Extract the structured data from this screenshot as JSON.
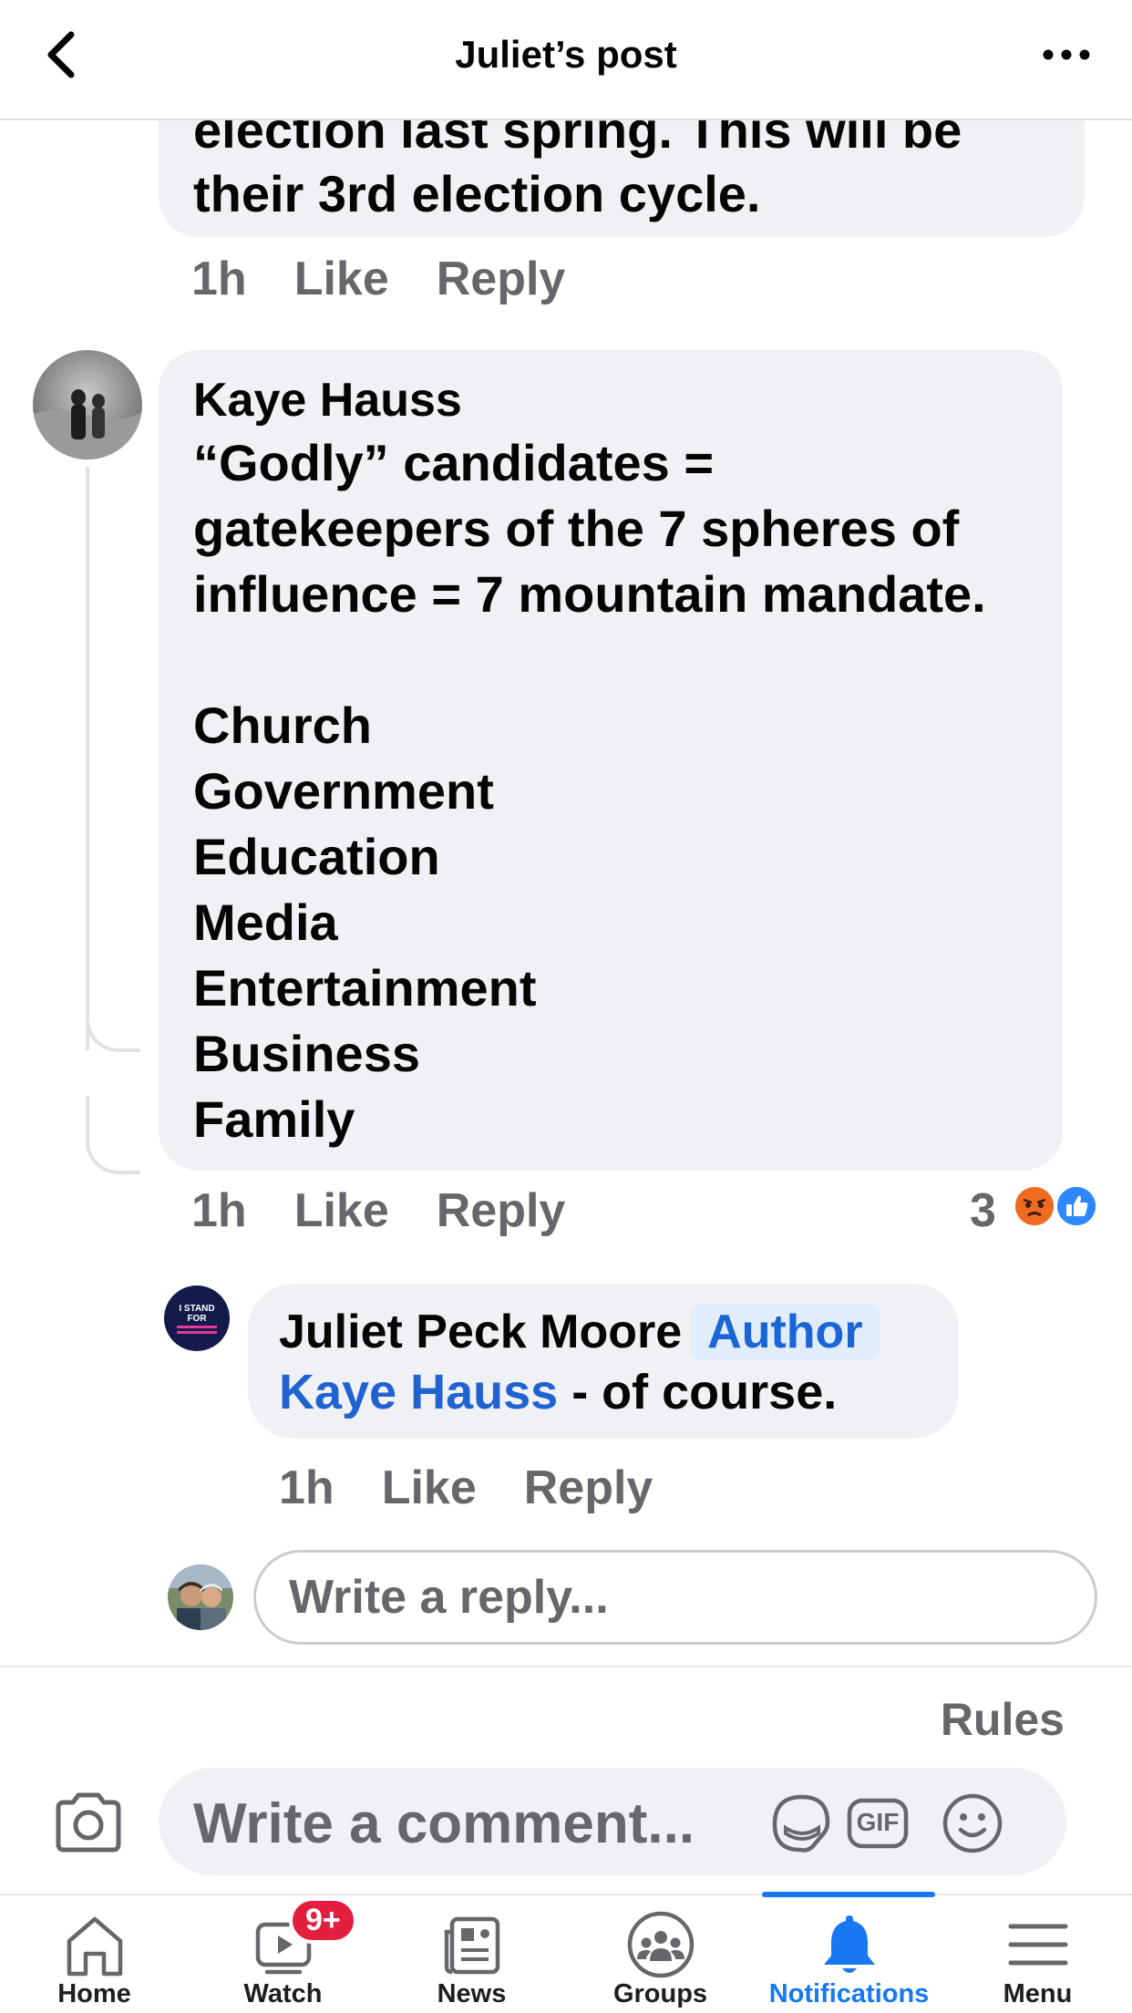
{
  "header": {
    "title": "Juliet’s post"
  },
  "comments": {
    "prev_tail_line1": "election last spring. This will be",
    "prev_tail_line2": "their 3rd election cycle.",
    "prev_meta": {
      "time": "1h",
      "like": "Like",
      "reply": "Reply"
    },
    "kaye": {
      "author": "Kaye Hauss",
      "lines": [
        "“Godly” candidates =",
        "gatekeepers of the 7 spheres of",
        "influence = 7 mountain mandate.",
        "",
        "Church",
        "Government",
        "Education",
        "Media",
        "Entertainment",
        "Business",
        "Family"
      ],
      "time": "1h",
      "like": "Like",
      "reply": "Reply",
      "reaction_count": "3"
    },
    "juliet_reply": {
      "author": "Juliet Peck Moore",
      "badge": "Author",
      "mention": "Kaye Hauss",
      "text": " - of course.",
      "avatar_text": "I STAND FOR",
      "time": "1h",
      "like": "Like",
      "reply": "Reply"
    },
    "reply_placeholder": "Write a reply..."
  },
  "composer": {
    "rules": "Rules",
    "placeholder": "Write a comment...",
    "gif_label": "GIF"
  },
  "tabs": [
    {
      "label": "Home",
      "icon": "home-icon"
    },
    {
      "label": "Watch",
      "icon": "watch-icon",
      "badge": "9+"
    },
    {
      "label": "News",
      "icon": "news-icon"
    },
    {
      "label": "Groups",
      "icon": "groups-icon"
    },
    {
      "label": "Notifications",
      "icon": "bell-icon",
      "active": true
    },
    {
      "label": "Menu",
      "icon": "menu-icon"
    }
  ],
  "colors": {
    "accent": "#1877f2",
    "bubble": "#f0f1f5",
    "secondary_text": "#65676b",
    "badge_red": "#e41e3f"
  }
}
